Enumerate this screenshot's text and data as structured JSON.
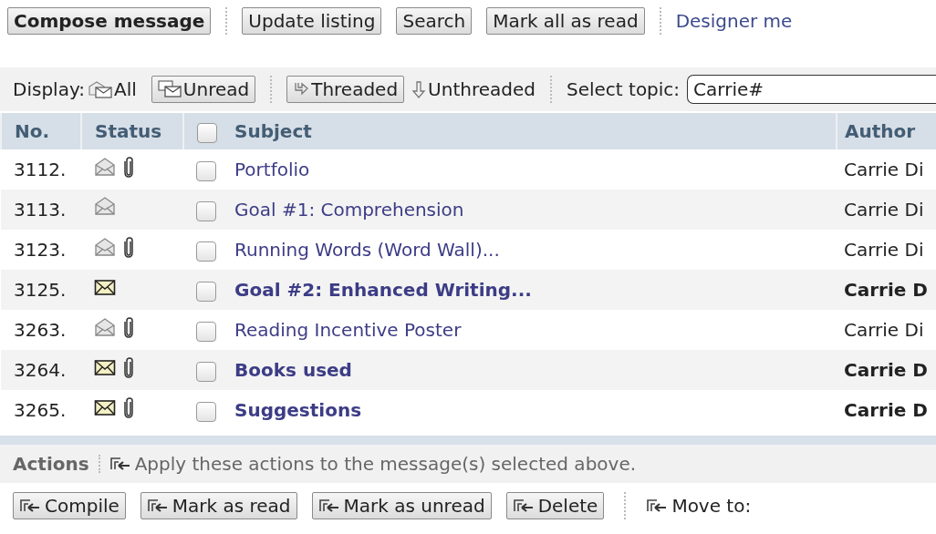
{
  "toolbar": {
    "primary_button": "Compose message",
    "buttons": [
      "Update listing",
      "Search",
      "Mark all as read"
    ],
    "link": "Designer me"
  },
  "display_bar": {
    "display_label": "Display:",
    "display_options": [
      {
        "label": "All",
        "selected": true
      },
      {
        "label": "Unread",
        "selected": false
      }
    ],
    "thread_options": [
      {
        "label": "Threaded",
        "selected": false
      },
      {
        "label": "Unthreaded",
        "selected": true
      }
    ],
    "topic_label": "Select topic:",
    "topic_value": "Carrie#"
  },
  "table": {
    "columns": [
      "No.",
      "Status",
      "Subject",
      "Author"
    ],
    "select_all_checked": false,
    "rows": [
      {
        "number": "3112.",
        "unread": false,
        "attachment": true,
        "checked": false,
        "subject": "Portfolio",
        "author": "Carrie Di"
      },
      {
        "number": "3113.",
        "unread": false,
        "attachment": false,
        "checked": false,
        "subject": "Goal #1: Comprehension",
        "author": "Carrie Di"
      },
      {
        "number": "3123.",
        "unread": false,
        "attachment": true,
        "checked": false,
        "subject": "Running Words (Word Wall)...",
        "author": "Carrie Di"
      },
      {
        "number": "3125.",
        "unread": true,
        "attachment": false,
        "checked": false,
        "subject": "Goal #2: Enhanced Writing...",
        "author": "Carrie D"
      },
      {
        "number": "3263.",
        "unread": false,
        "attachment": true,
        "checked": false,
        "subject": "Reading Incentive Poster",
        "author": "Carrie Di"
      },
      {
        "number": "3264.",
        "unread": true,
        "attachment": true,
        "checked": false,
        "subject": "Books used",
        "author": "Carrie D"
      },
      {
        "number": "3265.",
        "unread": true,
        "attachment": true,
        "checked": false,
        "subject": "Suggestions",
        "author": "Carrie D"
      }
    ]
  },
  "actions": {
    "label": "Actions",
    "hint": "Apply these actions to the message(s) selected above.",
    "buttons": [
      "Compile",
      "Mark as read",
      "Mark as unread",
      "Delete"
    ],
    "move_label": "Move to:"
  }
}
